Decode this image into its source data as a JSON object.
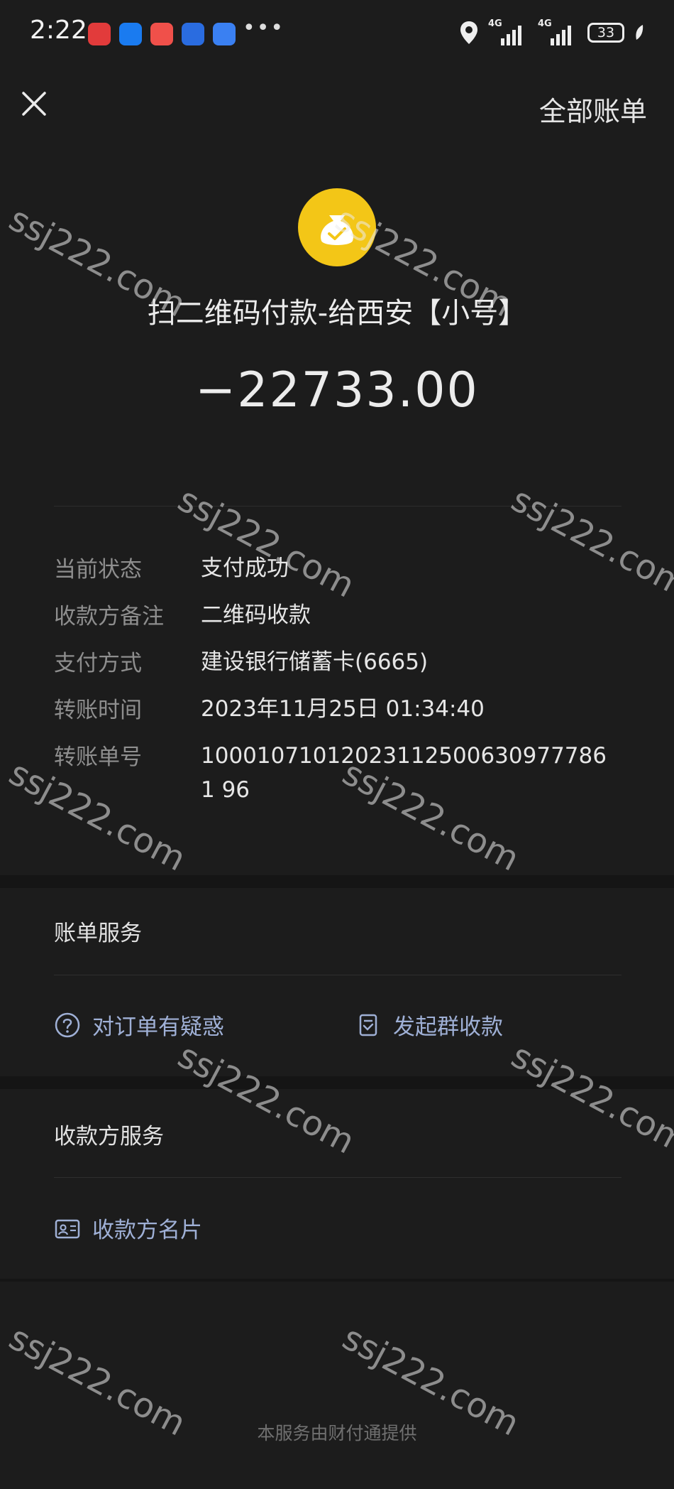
{
  "status_bar": {
    "time": "2:22",
    "signal1_label": "4G",
    "signal2_label": "4G",
    "battery": "33",
    "more_icon": "•••"
  },
  "topbar": {
    "all_bills_label": "全部账单"
  },
  "payment": {
    "title": "扫二维码付款-给西安【小号】",
    "amount": "−22733.00"
  },
  "details": [
    {
      "key": "当前状态",
      "value": "支付成功"
    },
    {
      "key": "收款方备注",
      "value": "二维码收款"
    },
    {
      "key": "支付方式",
      "value": "建设银行储蓄卡(6665)"
    },
    {
      "key": "转账时间",
      "value": "2023年11月25日 01:34:40"
    },
    {
      "key": "转账单号",
      "value": "100010710120231125006309777861 96"
    }
  ],
  "bill_services": {
    "title": "账单服务",
    "question_label": "对订单有疑惑",
    "group_collect_label": "发起群收款"
  },
  "payee_services": {
    "title": "收款方服务",
    "payee_card_label": "收款方名片"
  },
  "footer": {
    "text": "本服务由财付通提供"
  },
  "watermark": "ssj222.com",
  "colors": {
    "background": "#1c1c1c",
    "logo_yellow": "#f3c617",
    "link_blue": "#9fb0d6"
  }
}
